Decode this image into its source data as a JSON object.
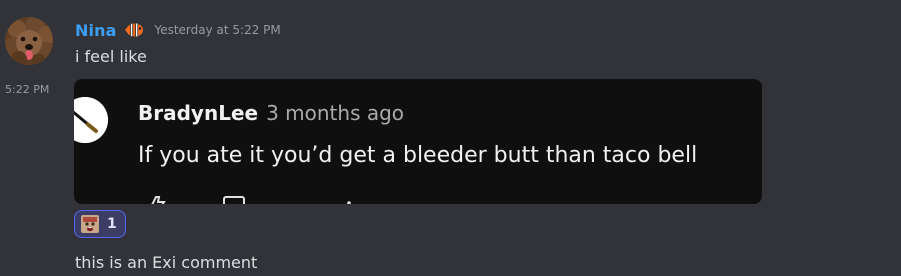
{
  "message": {
    "author": "Nina",
    "timestamp": "Yesterday at 5:22 PM",
    "role_icon": "clownfish-icon",
    "lines": [
      "i feel like",
      "this is an Exi comment"
    ],
    "followup_timestamp": "5:22 PM"
  },
  "embed": {
    "author": "BradynLee",
    "age": "3 months ago",
    "comment": "If you ate it you’d get a bleeder butt than taco bell",
    "avatar_icon": "knife-avatar-icon"
  },
  "reaction": {
    "emoji": "pepe-emoji-icon",
    "count": "1"
  },
  "colors": {
    "background": "#313338",
    "username": "#3b9ef2",
    "embed_background": "#0f0f0f",
    "reaction_background": "#3b3d66",
    "reaction_border": "#5865f2"
  }
}
